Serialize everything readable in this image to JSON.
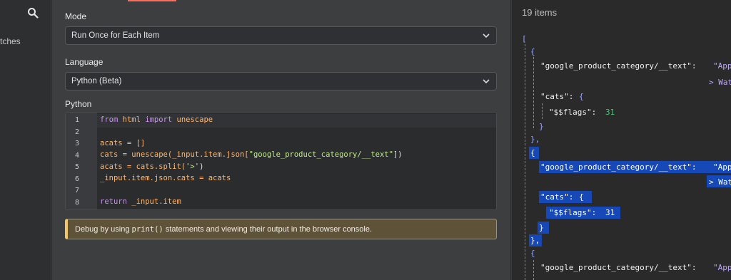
{
  "sidebar": {
    "partial_label": "tches"
  },
  "params": {
    "mode_label": "Mode",
    "mode_value": "Run Once for Each Item",
    "language_label": "Language",
    "language_value": "Python (Beta)",
    "editor_label": "Python"
  },
  "code": {
    "line_numbers": [
      "1",
      "2",
      "3",
      "4",
      "5",
      "6",
      "7",
      "8"
    ],
    "line1_kw1": "from",
    "line1_mod": "html",
    "line1_kw2": "import",
    "line1_fn": "unescape",
    "line3": "acats = []",
    "line4_a": "cats = ",
    "line4_fn": "unescape",
    "line4_b": "(_input.item.json[",
    "line4_str": "\"google_product_category/__text\"",
    "line4_c": "])",
    "line5_a": "acats = cats.split(",
    "line5_str": "'>'",
    "line5_b": ")",
    "line6": "_input.item.json.cats = acats",
    "line8_kw": "return",
    "line8_rest": " _input.item"
  },
  "debug": {
    "pre": "Debug by using ",
    "code": "print()",
    "post": " statements and viewing their output in the browser console."
  },
  "output": {
    "items_count": "19 items",
    "open_bracket": "[",
    "open_brace": "{",
    "close_brace": "}",
    "close_brace_comma": "},",
    "key_gpc": "\"google_product_category/__text\":",
    "val_gpc_partial": "\"App",
    "val_cont_partial": "> Wat",
    "key_cats": "\"cats\":",
    "brace_open": "{",
    "key_flags": "\"$$flags\":",
    "val_flags": "31"
  }
}
